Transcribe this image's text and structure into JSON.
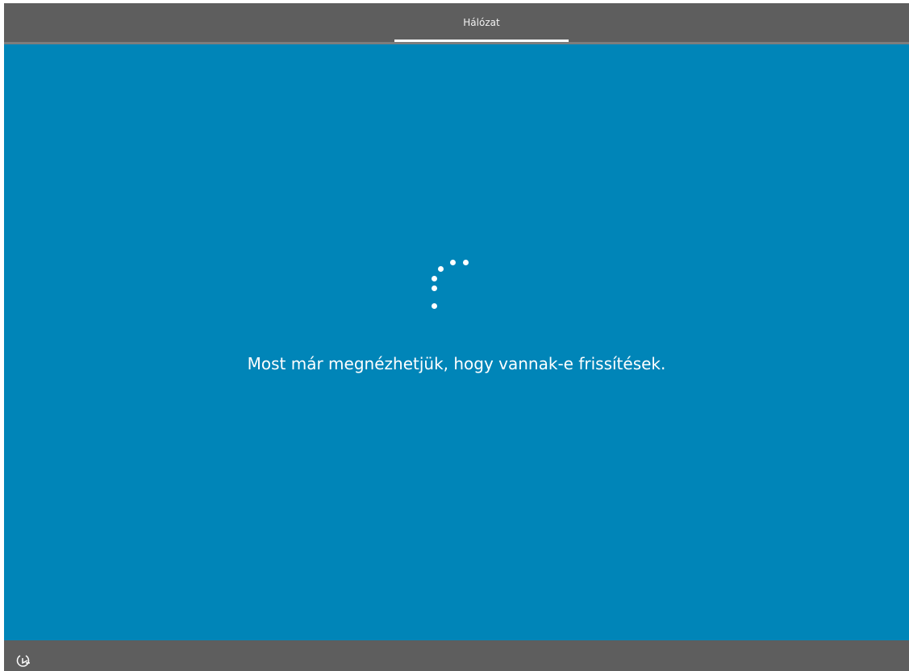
{
  "header": {
    "tabs": [
      {
        "label": "Hálózat",
        "active": true
      }
    ]
  },
  "main": {
    "spinner_icon": "loading-dots-spinner",
    "message": "Most már megnézhetjük, hogy vannak-e frissítések."
  },
  "footer": {
    "ease_of_access_icon": "ease-of-access-icon"
  },
  "colors": {
    "background": "#0085b8",
    "bars": "#5e5e5e",
    "text": "#ffffff"
  }
}
